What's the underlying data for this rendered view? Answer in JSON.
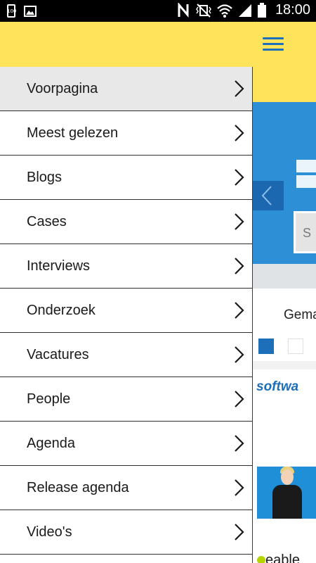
{
  "status_bar": {
    "battery_level_text": "100",
    "time": "18:00",
    "icons": [
      "battery-saver-icon",
      "gallery-icon",
      "nfc-icon",
      "vibrate-icon",
      "wifi-icon",
      "signal-icon",
      "battery-icon"
    ]
  },
  "header": {
    "menu_icon": "hamburger-menu-icon",
    "background_color": "#ffe35a",
    "accent_color": "#1e6fba"
  },
  "drawer": {
    "items": [
      {
        "label": "Voorpagina",
        "selected": true
      },
      {
        "label": "Meest gelezen",
        "selected": false
      },
      {
        "label": "Blogs",
        "selected": false
      },
      {
        "label": "Cases",
        "selected": false
      },
      {
        "label": "Interviews",
        "selected": false
      },
      {
        "label": "Onderzoek",
        "selected": false
      },
      {
        "label": "Vacatures",
        "selected": false
      },
      {
        "label": "People",
        "selected": false
      },
      {
        "label": "Agenda",
        "selected": false
      },
      {
        "label": "Release agenda",
        "selected": false
      },
      {
        "label": "Video's",
        "selected": false
      }
    ]
  },
  "background_page": {
    "search_placeholder_fragment": "S",
    "section_label_fragment": "Gema",
    "brand_fragment": "softwa",
    "brand2_fragment": "eable",
    "carousel_dot_count": 2,
    "carousel_active_index": 0
  }
}
